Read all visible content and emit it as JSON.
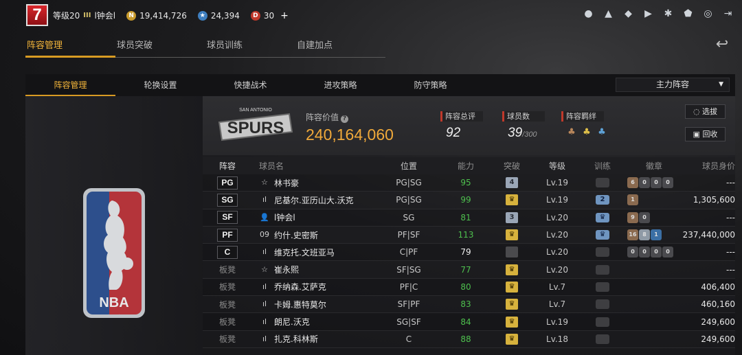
{
  "topbar": {
    "level_badge": "7",
    "level_text": "等级20",
    "vip_text": "III",
    "username": "l钟会l",
    "gold": "19,414,726",
    "stars": "24,394",
    "tickets": "30",
    "plus": "+"
  },
  "main_tabs": [
    {
      "label": "阵容管理",
      "active": true
    },
    {
      "label": "球员突破",
      "active": false
    },
    {
      "label": "球员训练",
      "active": false
    },
    {
      "label": "自建加点",
      "active": false
    }
  ],
  "sub_tabs": [
    {
      "label": "阵容管理",
      "active": true
    },
    {
      "label": "轮换设置",
      "active": false
    },
    {
      "label": "快捷战术",
      "active": false
    },
    {
      "label": "进攻策略",
      "active": false
    },
    {
      "label": "防守策略",
      "active": false
    }
  ],
  "lineup_select": {
    "value": "主力阵容"
  },
  "team": {
    "logo_text": "SPURS",
    "logo_small": "SAN ANTONIO"
  },
  "summary": {
    "value_label": "阵容价值",
    "value": "240,164,060",
    "rating_label": "阵容总评",
    "rating": "92",
    "count_label": "球员数",
    "count": "39",
    "count_max": "/300",
    "bond_label": "阵容羁绊"
  },
  "buttons": {
    "select": "选拔",
    "recycle": "回收"
  },
  "table": {
    "headers": {
      "pos": "阵容",
      "name": "球员名",
      "loc": "位置",
      "ability": "能力",
      "break": "突破",
      "grade": "等级",
      "train": "训练",
      "badge": "徽章",
      "value": "球员身价"
    },
    "rows": [
      {
        "pos": "PG",
        "role": "☆",
        "name": "林书豪",
        "loc": "PG|SG",
        "ability": "95",
        "ability_color": "green",
        "brk": "4",
        "grade": "Lv.19",
        "train": "",
        "badges": [
          "6",
          "0",
          "0",
          "0"
        ],
        "value": "---"
      },
      {
        "pos": "SG",
        "role": "ıl",
        "name": "尼基尔.亚历山大.沃克",
        "loc": "PG|SG",
        "ability": "99",
        "ability_color": "green",
        "brk": "♛",
        "grade": "Lv.19",
        "train": "2",
        "badges": [
          "1"
        ],
        "value": "1,305,600"
      },
      {
        "pos": "SF",
        "role": "👤",
        "name": "l钟会l",
        "loc": "SG",
        "ability": "81",
        "ability_color": "green",
        "brk": "3",
        "grade": "Lv.20",
        "train": "♛",
        "badges": [
          "9",
          "0"
        ],
        "value": "---"
      },
      {
        "pos": "PF",
        "role": "09",
        "name": "约什.史密斯",
        "loc": "PF|SF",
        "ability": "113",
        "ability_color": "green",
        "brk": "♛",
        "grade": "Lv.20",
        "train": "♛",
        "badges": [
          "16",
          "8",
          "1"
        ],
        "value": "237,440,000"
      },
      {
        "pos": "C",
        "role": "ıl",
        "name": "维克托.文班亚马",
        "loc": "C|PF",
        "ability": "79",
        "ability_color": "white",
        "brk": "",
        "grade": "Lv.20",
        "train": "",
        "badges": [
          "0",
          "0",
          "0",
          "0"
        ],
        "value": "---"
      },
      {
        "pos": "板凳",
        "role": "☆",
        "name": "崔永熙",
        "loc": "SF|SG",
        "ability": "77",
        "ability_color": "green",
        "brk": "♛",
        "grade": "Lv.20",
        "train": "",
        "badges": [],
        "value": "---"
      },
      {
        "pos": "板凳",
        "role": "ıl",
        "name": "乔纳森.艾萨克",
        "loc": "PF|C",
        "ability": "80",
        "ability_color": "green",
        "brk": "♛",
        "grade": "Lv.7",
        "train": "",
        "badges": [],
        "value": "406,400"
      },
      {
        "pos": "板凳",
        "role": "ıl",
        "name": "卡姆.惠特莫尔",
        "loc": "SF|PF",
        "ability": "83",
        "ability_color": "green",
        "brk": "♛",
        "grade": "Lv.7",
        "train": "",
        "badges": [],
        "value": "460,160"
      },
      {
        "pos": "板凳",
        "role": "ıl",
        "name": "朗尼.沃克",
        "loc": "SG|SF",
        "ability": "84",
        "ability_color": "green",
        "brk": "♛",
        "grade": "Lv.19",
        "train": "",
        "badges": [],
        "value": "249,600"
      },
      {
        "pos": "板凳",
        "role": "ıl",
        "name": "扎克.科林斯",
        "loc": "C",
        "ability": "88",
        "ability_color": "green",
        "brk": "♛",
        "grade": "Lv.18",
        "train": "",
        "badges": [],
        "value": "249,600"
      }
    ]
  }
}
